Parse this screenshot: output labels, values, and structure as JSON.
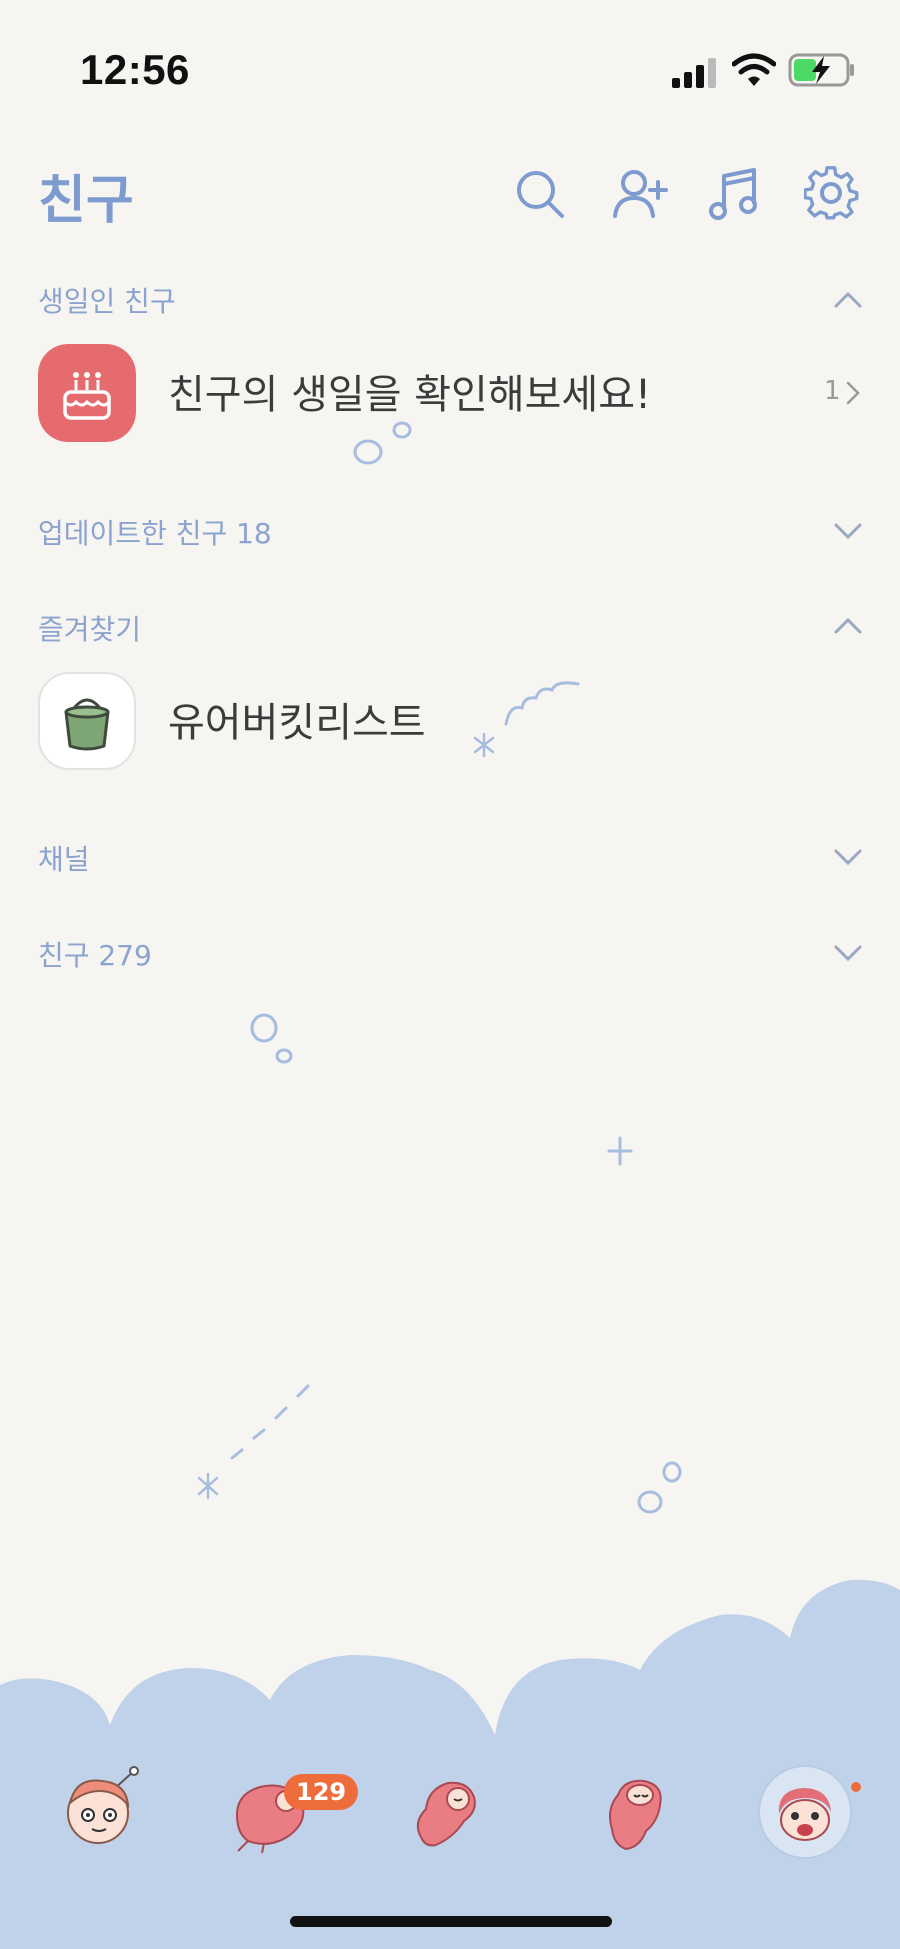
{
  "status_bar": {
    "time": "12:56"
  },
  "header": {
    "title": "친구"
  },
  "sections": {
    "birthday": {
      "label": "생일인 친구",
      "row_text": "친구의 생일을 확인해보세요!",
      "count": "1"
    },
    "updated": {
      "label": "업데이트한 친구 18"
    },
    "favorites": {
      "label": "즐겨찾기",
      "row_text": "유어버킷리스트"
    },
    "channel": {
      "label": "채널"
    },
    "friends": {
      "label": "친구 279"
    }
  },
  "tabbar": {
    "badge": "129"
  },
  "colors": {
    "accent": "#8aa3cf",
    "badge": "#ee6b3c",
    "wave": "#c0d2e9",
    "background": "#f7f5f2"
  }
}
